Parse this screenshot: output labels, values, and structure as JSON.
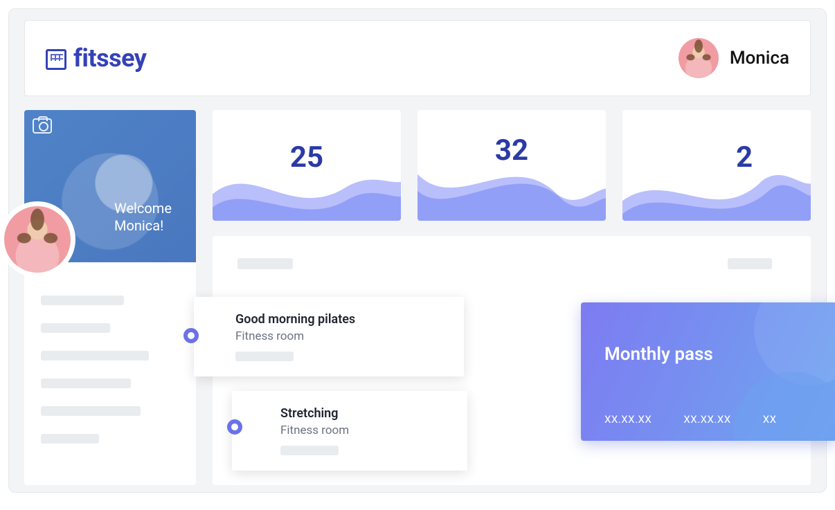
{
  "brand": {
    "name": "fitssey"
  },
  "user": {
    "name": "Monica"
  },
  "sidebar": {
    "welcome_line1": "Welcome",
    "welcome_line2": "Monica!"
  },
  "stats": [
    {
      "value": "25"
    },
    {
      "value": "32"
    },
    {
      "value": "2"
    }
  ],
  "classes": [
    {
      "title": "Good morning pilates",
      "room": "Fitness room"
    },
    {
      "title": "Stretching",
      "room": "Fitness room"
    }
  ],
  "pass": {
    "title": "Monthly pass",
    "date1": "XX.XX.XX",
    "date2": "XX.XX.XX",
    "date3": "XX"
  }
}
